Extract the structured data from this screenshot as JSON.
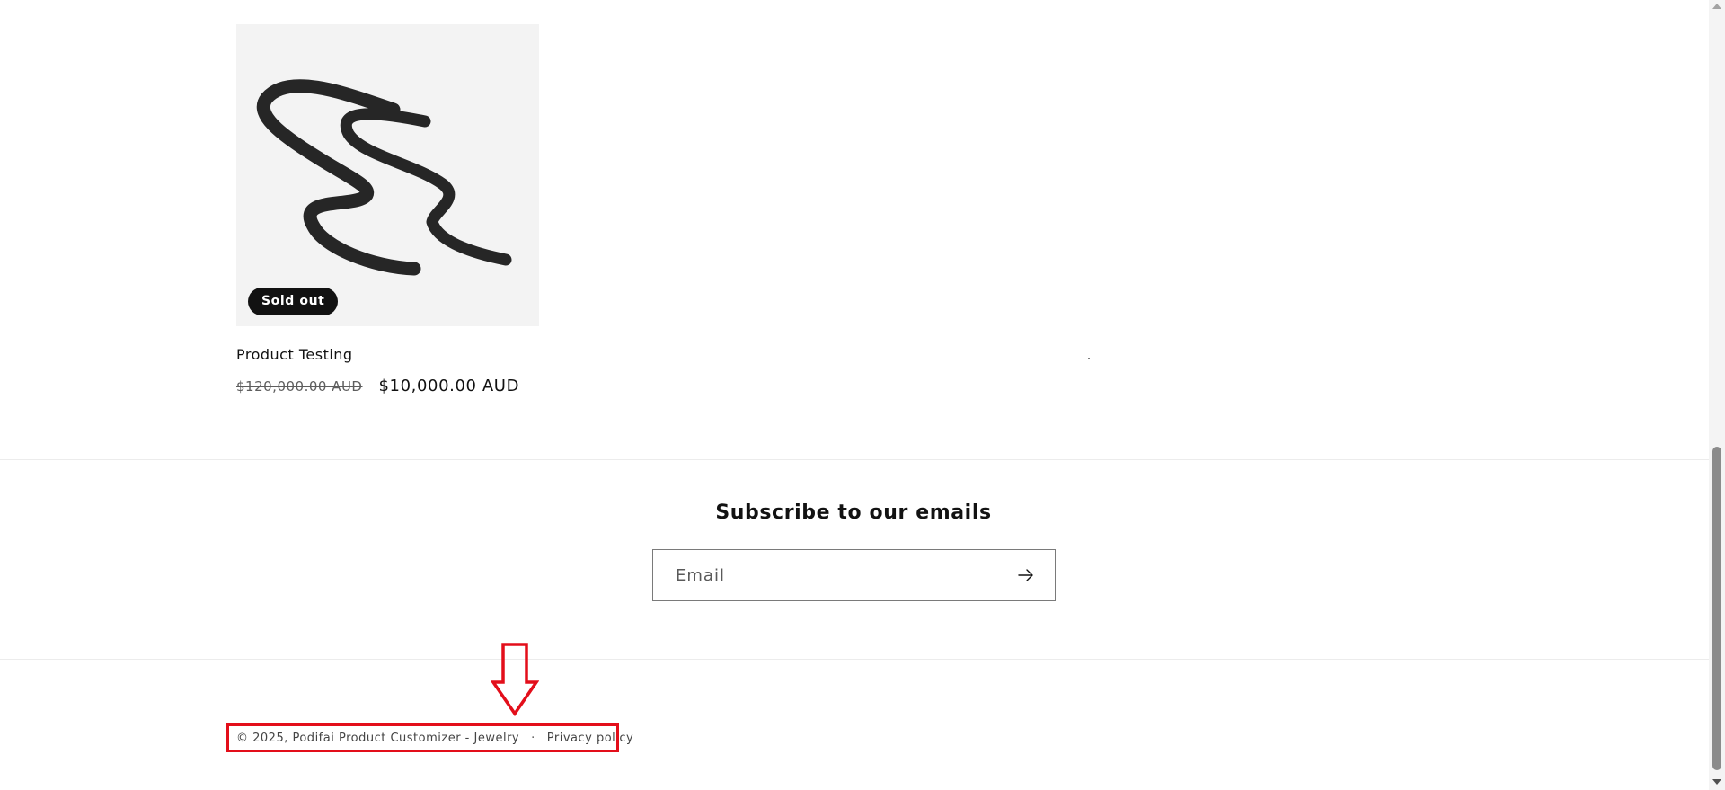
{
  "product": {
    "badge": "Sold out",
    "title": "Product Testing",
    "compare_price": "$120,000.00 AUD",
    "price": "$10,000.00 AUD",
    "image_icon": "scribble-artwork"
  },
  "newsletter": {
    "heading": "Subscribe to our emails",
    "email_placeholder": "Email",
    "submit_icon": "arrow-right-icon"
  },
  "footer": {
    "copyright": "© 2025, Podifai Product Customizer - Jewelry",
    "separator": "·",
    "privacy_link": "Privacy policy"
  },
  "annotation": {
    "color": "#e30e1a",
    "arrow_icon": "down-arrow-icon"
  }
}
